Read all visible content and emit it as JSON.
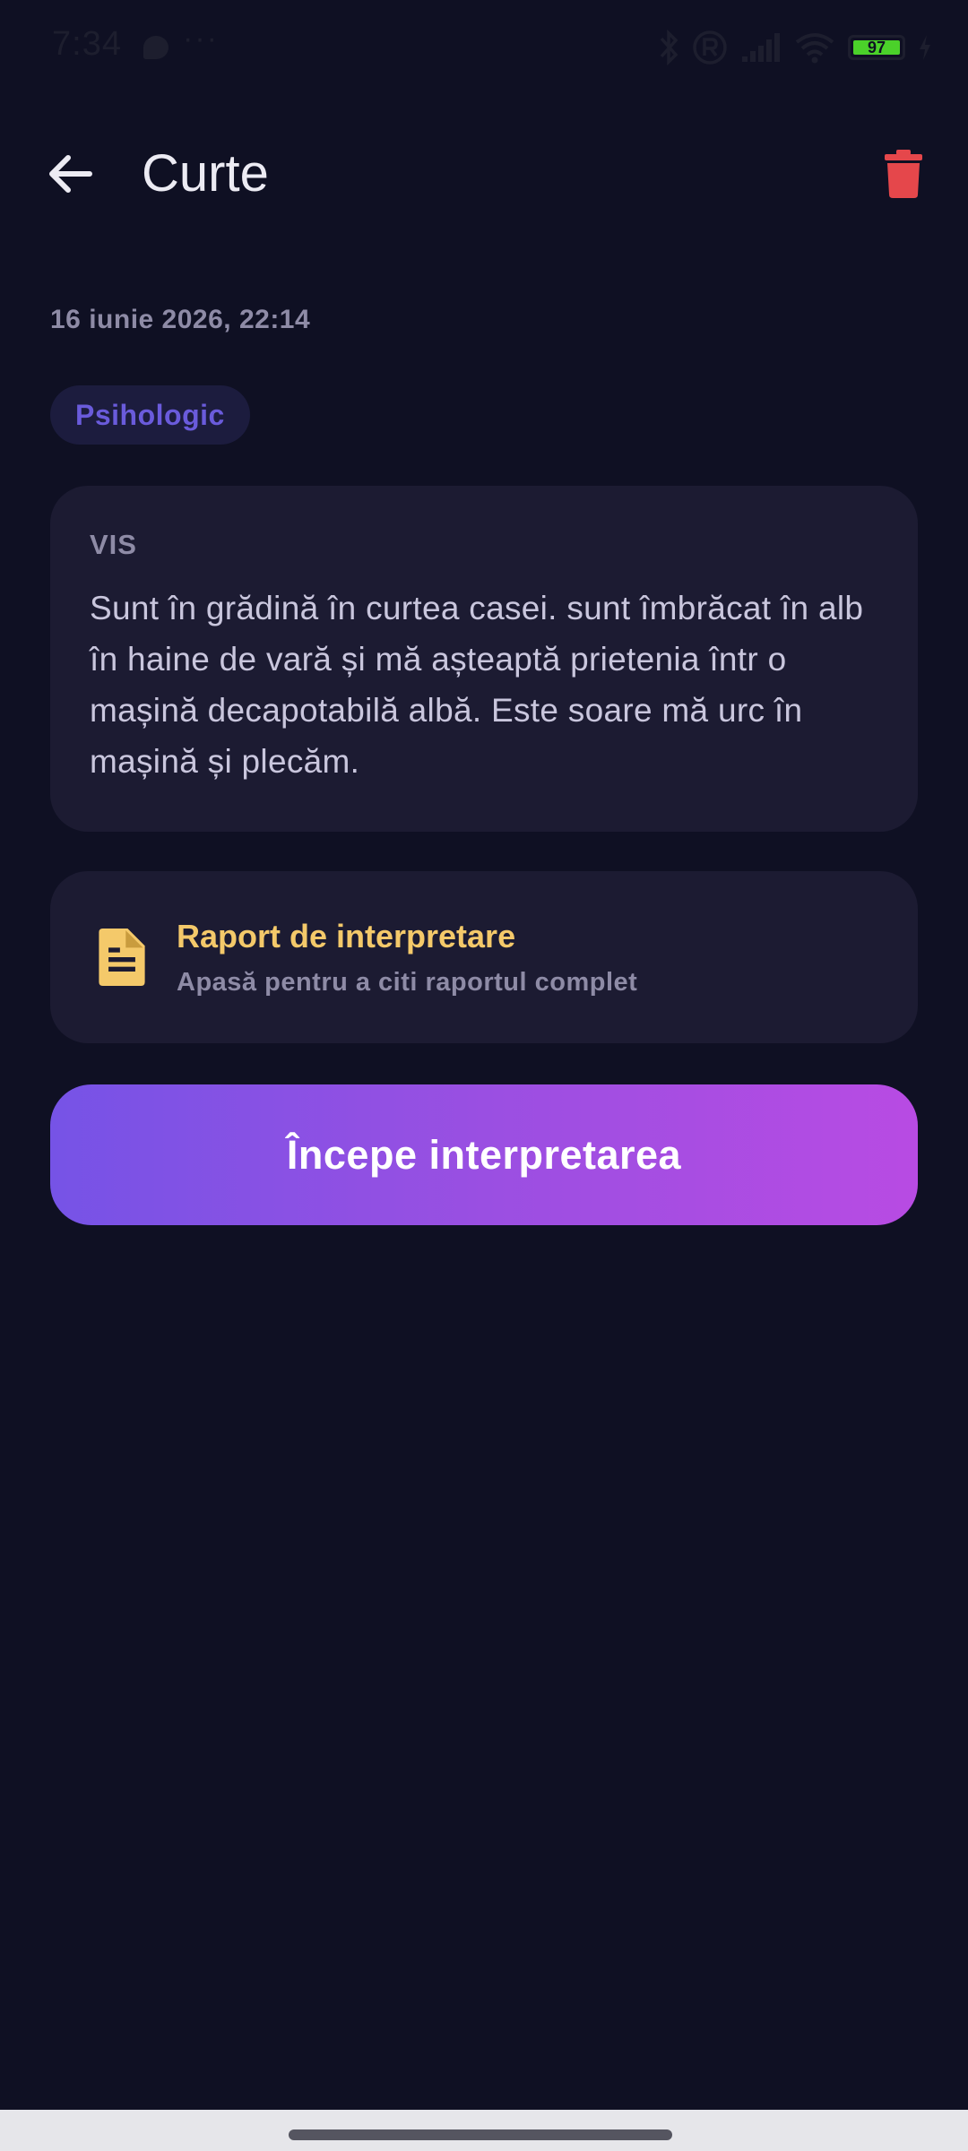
{
  "status_bar": {
    "time": "7:34",
    "dots": "···",
    "battery_level": "97",
    "colors": {
      "battery_fill": "#4bd12a",
      "icons": "#1d1e2e"
    },
    "icons": [
      "message-icon",
      "bluetooth-icon",
      "registered-icon",
      "signal-icon",
      "wifi-icon",
      "battery-icon",
      "charging-icon"
    ]
  },
  "app_bar": {
    "title": "Curte",
    "back_icon": "arrow-left-icon",
    "delete_icon": "trash-icon",
    "colors": {
      "delete": "#e5474b"
    }
  },
  "dream": {
    "date": "16 iunie 2026, 22:14",
    "category": "Psihologic",
    "label": "VIS",
    "text": "Sunt în grădină în curtea casei.  sunt îmbrăcat în alb în haine de vară și mă așteaptă prietenia într o mașină decapotabilă albă.  Este soare mă urc în mașină și plecăm."
  },
  "report": {
    "icon": "document-icon",
    "title": "Raport de interpretare",
    "subtitle": "Apasă pentru a citi raportul complet",
    "colors": {
      "title": "#f4c96a"
    }
  },
  "actions": {
    "start_label": "Începe interpretarea",
    "colors": {
      "gradient_start": "#7653e6",
      "gradient_end": "#b84be3"
    }
  },
  "theme": {
    "background": "#0f1023",
    "card": "#1c1b32",
    "chip_text": "#6a5bdb"
  }
}
